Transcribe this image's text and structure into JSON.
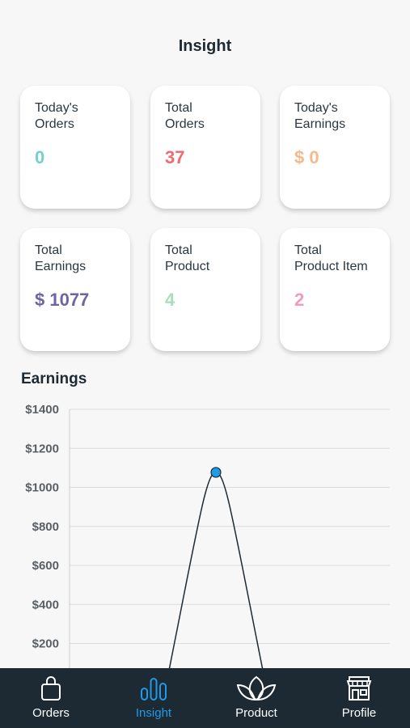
{
  "header": {
    "title": "Insight"
  },
  "cards": [
    {
      "label": "Today's\nOrders",
      "value": "0",
      "color": "#6fd3c8"
    },
    {
      "label": "Total\nOrders",
      "value": "37",
      "color": "#f06a6f"
    },
    {
      "label": "Today's\nEarnings",
      "value": "$ 0",
      "color": "#f6b98a"
    },
    {
      "label": "Total\nEarnings",
      "value": "$ 1077",
      "color": "#6e64a4"
    },
    {
      "label": "Total\nProduct",
      "value": "4",
      "color": "#a6dfb9"
    },
    {
      "label": "Total\nProduct Item",
      "value": "2",
      "color": "#f39ac0"
    }
  ],
  "earnings": {
    "title": "Earnings"
  },
  "chart_data": {
    "type": "line",
    "title": "Earnings",
    "yticks": [
      "$1400",
      "$1200",
      "$1000",
      "$800",
      "$600",
      "$400",
      "$200"
    ],
    "ylim": [
      0,
      1400
    ],
    "series": [
      {
        "values": [
          0,
          1077,
          0
        ]
      }
    ],
    "grid": true,
    "colors": {
      "line": "#1e2a33",
      "point": "#1e9be8"
    }
  },
  "tabs": [
    {
      "label": "Orders",
      "icon": "bag-icon",
      "active": false
    },
    {
      "label": "Insight",
      "icon": "bar-chart-icon",
      "active": true
    },
    {
      "label": "Product",
      "icon": "leaf-icon",
      "active": false
    },
    {
      "label": "Profile",
      "icon": "store-icon",
      "active": false
    }
  ],
  "colors": {
    "accent": "#1e9be8",
    "tab_bar": "#1d2a33"
  }
}
